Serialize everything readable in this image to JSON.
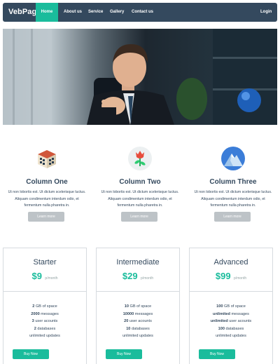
{
  "navbar": {
    "brand": "VebPage",
    "items": [
      {
        "label": "Home"
      },
      {
        "label": "About us"
      },
      {
        "label": "Service"
      },
      {
        "label": "Gallery"
      },
      {
        "label": "Contact us"
      }
    ],
    "login": "Login"
  },
  "colors": {
    "nav_bg": "#34495e",
    "accent": "#1abc9c",
    "muted_button": "#bdc3c7"
  },
  "features": [
    {
      "icon": "building-icon",
      "title": "Column One",
      "lines": [
        "Ut non lobortis est. Ut dictum scelerisque luctus.",
        "Aliquam condimentum interdum odio, et",
        "fermentum nulla pharetra in."
      ],
      "button": "Learn more"
    },
    {
      "icon": "flower-icon",
      "title": "Column Two",
      "lines": [
        "Ut non lobortis est. Ut dictum scelerisque luctus.",
        "Aliquam condimentum interdum odio, et",
        "fermentum nulla pharetra in."
      ],
      "button": "Learn more"
    },
    {
      "icon": "mountain-icon",
      "title": "Column Three",
      "lines": [
        "Ut non lobortis est. Ut dictum scelerisque luctus.",
        "Aliquam condimentum interdum odio, et",
        "fermentum nulla pharetra in."
      ],
      "button": "Learn more"
    }
  ],
  "plans": [
    {
      "name": "Starter",
      "price": "$9",
      "unit": "p/month",
      "features": [
        {
          "strong": "2",
          "text": " GB of space"
        },
        {
          "strong": "2000",
          "text": " messages"
        },
        {
          "strong": "3",
          "text": " user acounts"
        },
        {
          "strong": "2",
          "text": " databases"
        },
        {
          "strong": "",
          "text": "unlimited updates"
        }
      ],
      "button": "Buy Now"
    },
    {
      "name": "Intermediate",
      "price": "$29",
      "unit": "p/month",
      "features": [
        {
          "strong": "10",
          "text": " GB of space"
        },
        {
          "strong": "10000",
          "text": " messages"
        },
        {
          "strong": "20",
          "text": " user acounts"
        },
        {
          "strong": "10",
          "text": " databases"
        },
        {
          "strong": "",
          "text": "unlimited updates"
        }
      ],
      "button": "Buy Now"
    },
    {
      "name": "Advanced",
      "price": "$99",
      "unit": "p/month",
      "features": [
        {
          "strong": "100",
          "text": " GB of space"
        },
        {
          "strong": "unlimited",
          "text": " messages"
        },
        {
          "strong": "unlimited",
          "text": " user acounts"
        },
        {
          "strong": "100",
          "text": " databases"
        },
        {
          "strong": "",
          "text": "unlimited updates"
        }
      ],
      "button": "Buy Now"
    }
  ]
}
